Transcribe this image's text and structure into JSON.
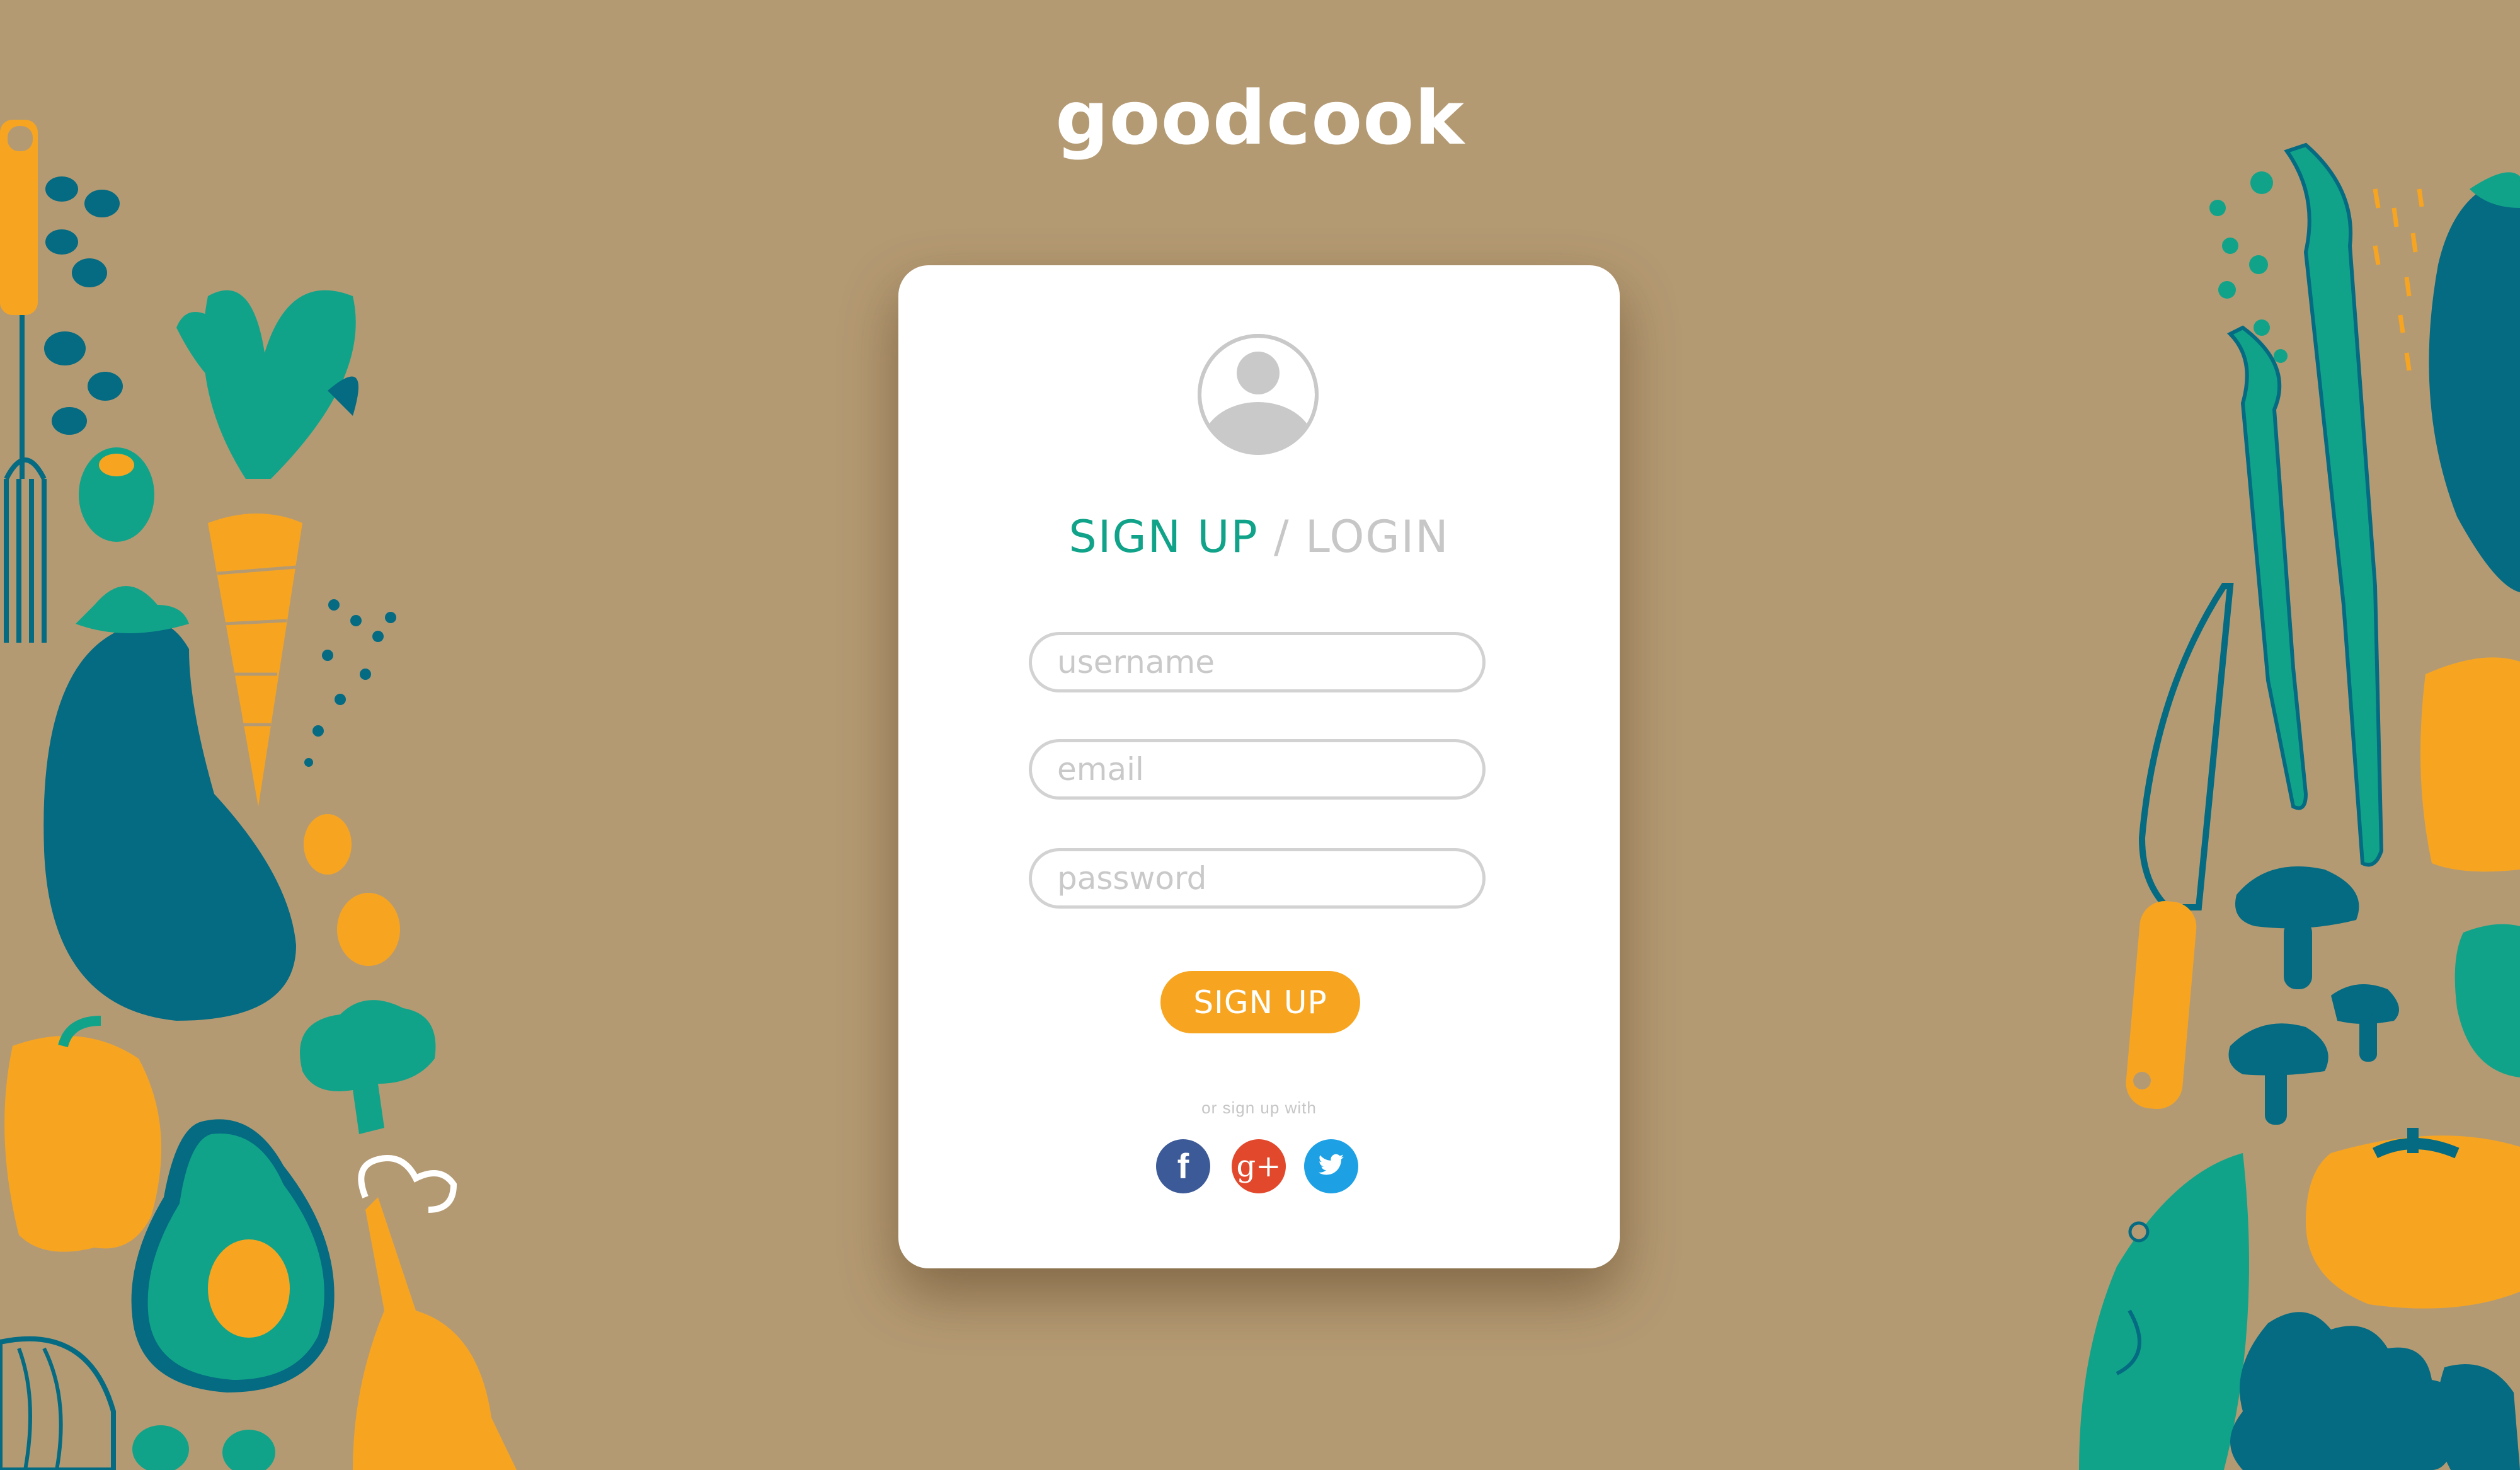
{
  "app": {
    "brand": "goodcook"
  },
  "form": {
    "heading": {
      "signup": "SIGN UP",
      "slash": " / ",
      "login": "LOGIN"
    },
    "fields": {
      "username": {
        "placeholder": "username",
        "value": ""
      },
      "email": {
        "placeholder": "email",
        "value": ""
      },
      "password": {
        "placeholder": "password",
        "value": ""
      }
    },
    "submit_label": "SIGN UP",
    "social_prompt": "or sign up with",
    "social": {
      "facebook": {
        "glyph": "f",
        "icon": "facebook-icon",
        "color": "#3d5a98"
      },
      "google": {
        "glyph": "g+",
        "icon": "google-plus-icon",
        "color": "#e2492c"
      },
      "twitter": {
        "icon": "twitter-icon",
        "color": "#1da1e4"
      }
    }
  },
  "colors": {
    "background": "#b49a73",
    "accent_green": "#11a389",
    "accent_orange": "#f7a521",
    "teal_dark": "#046b82"
  }
}
